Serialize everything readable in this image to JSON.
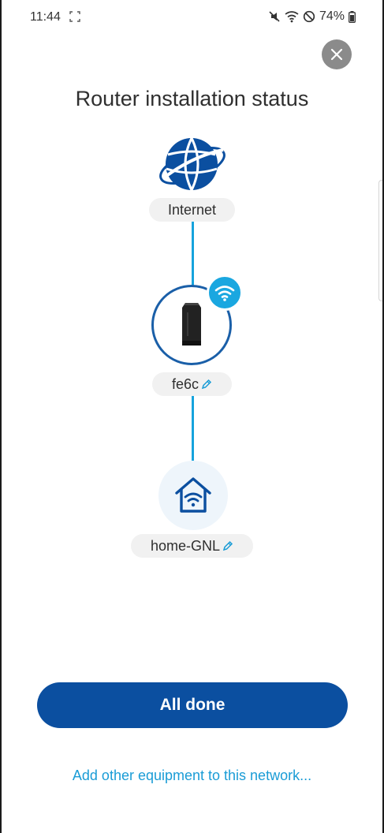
{
  "status_bar": {
    "time": "11:44",
    "battery": "74%",
    "icons": [
      "screen-capture-icon",
      "mute-icon",
      "wifi-icon",
      "do-not-disturb-icon",
      "battery-icon"
    ]
  },
  "close_icon": "close-icon",
  "title": "Router installation status",
  "nodes": {
    "internet": {
      "label": "Internet",
      "icon": "globe-icon"
    },
    "router": {
      "label": "fe6c",
      "icon": "router-icon",
      "badge_icon": "wifi-icon",
      "edit_icon": "pencil-icon"
    },
    "network": {
      "label": "home-GNL",
      "icon": "home-wifi-icon",
      "edit_icon": "pencil-icon"
    }
  },
  "primary_button": {
    "label": "All done"
  },
  "secondary_link": {
    "label": "Add other equipment to this network..."
  },
  "colors": {
    "primary": "#0b4fa0",
    "accent": "#1aa7e0",
    "link": "#1a9cd6",
    "close_bg": "#8b8b8b"
  }
}
